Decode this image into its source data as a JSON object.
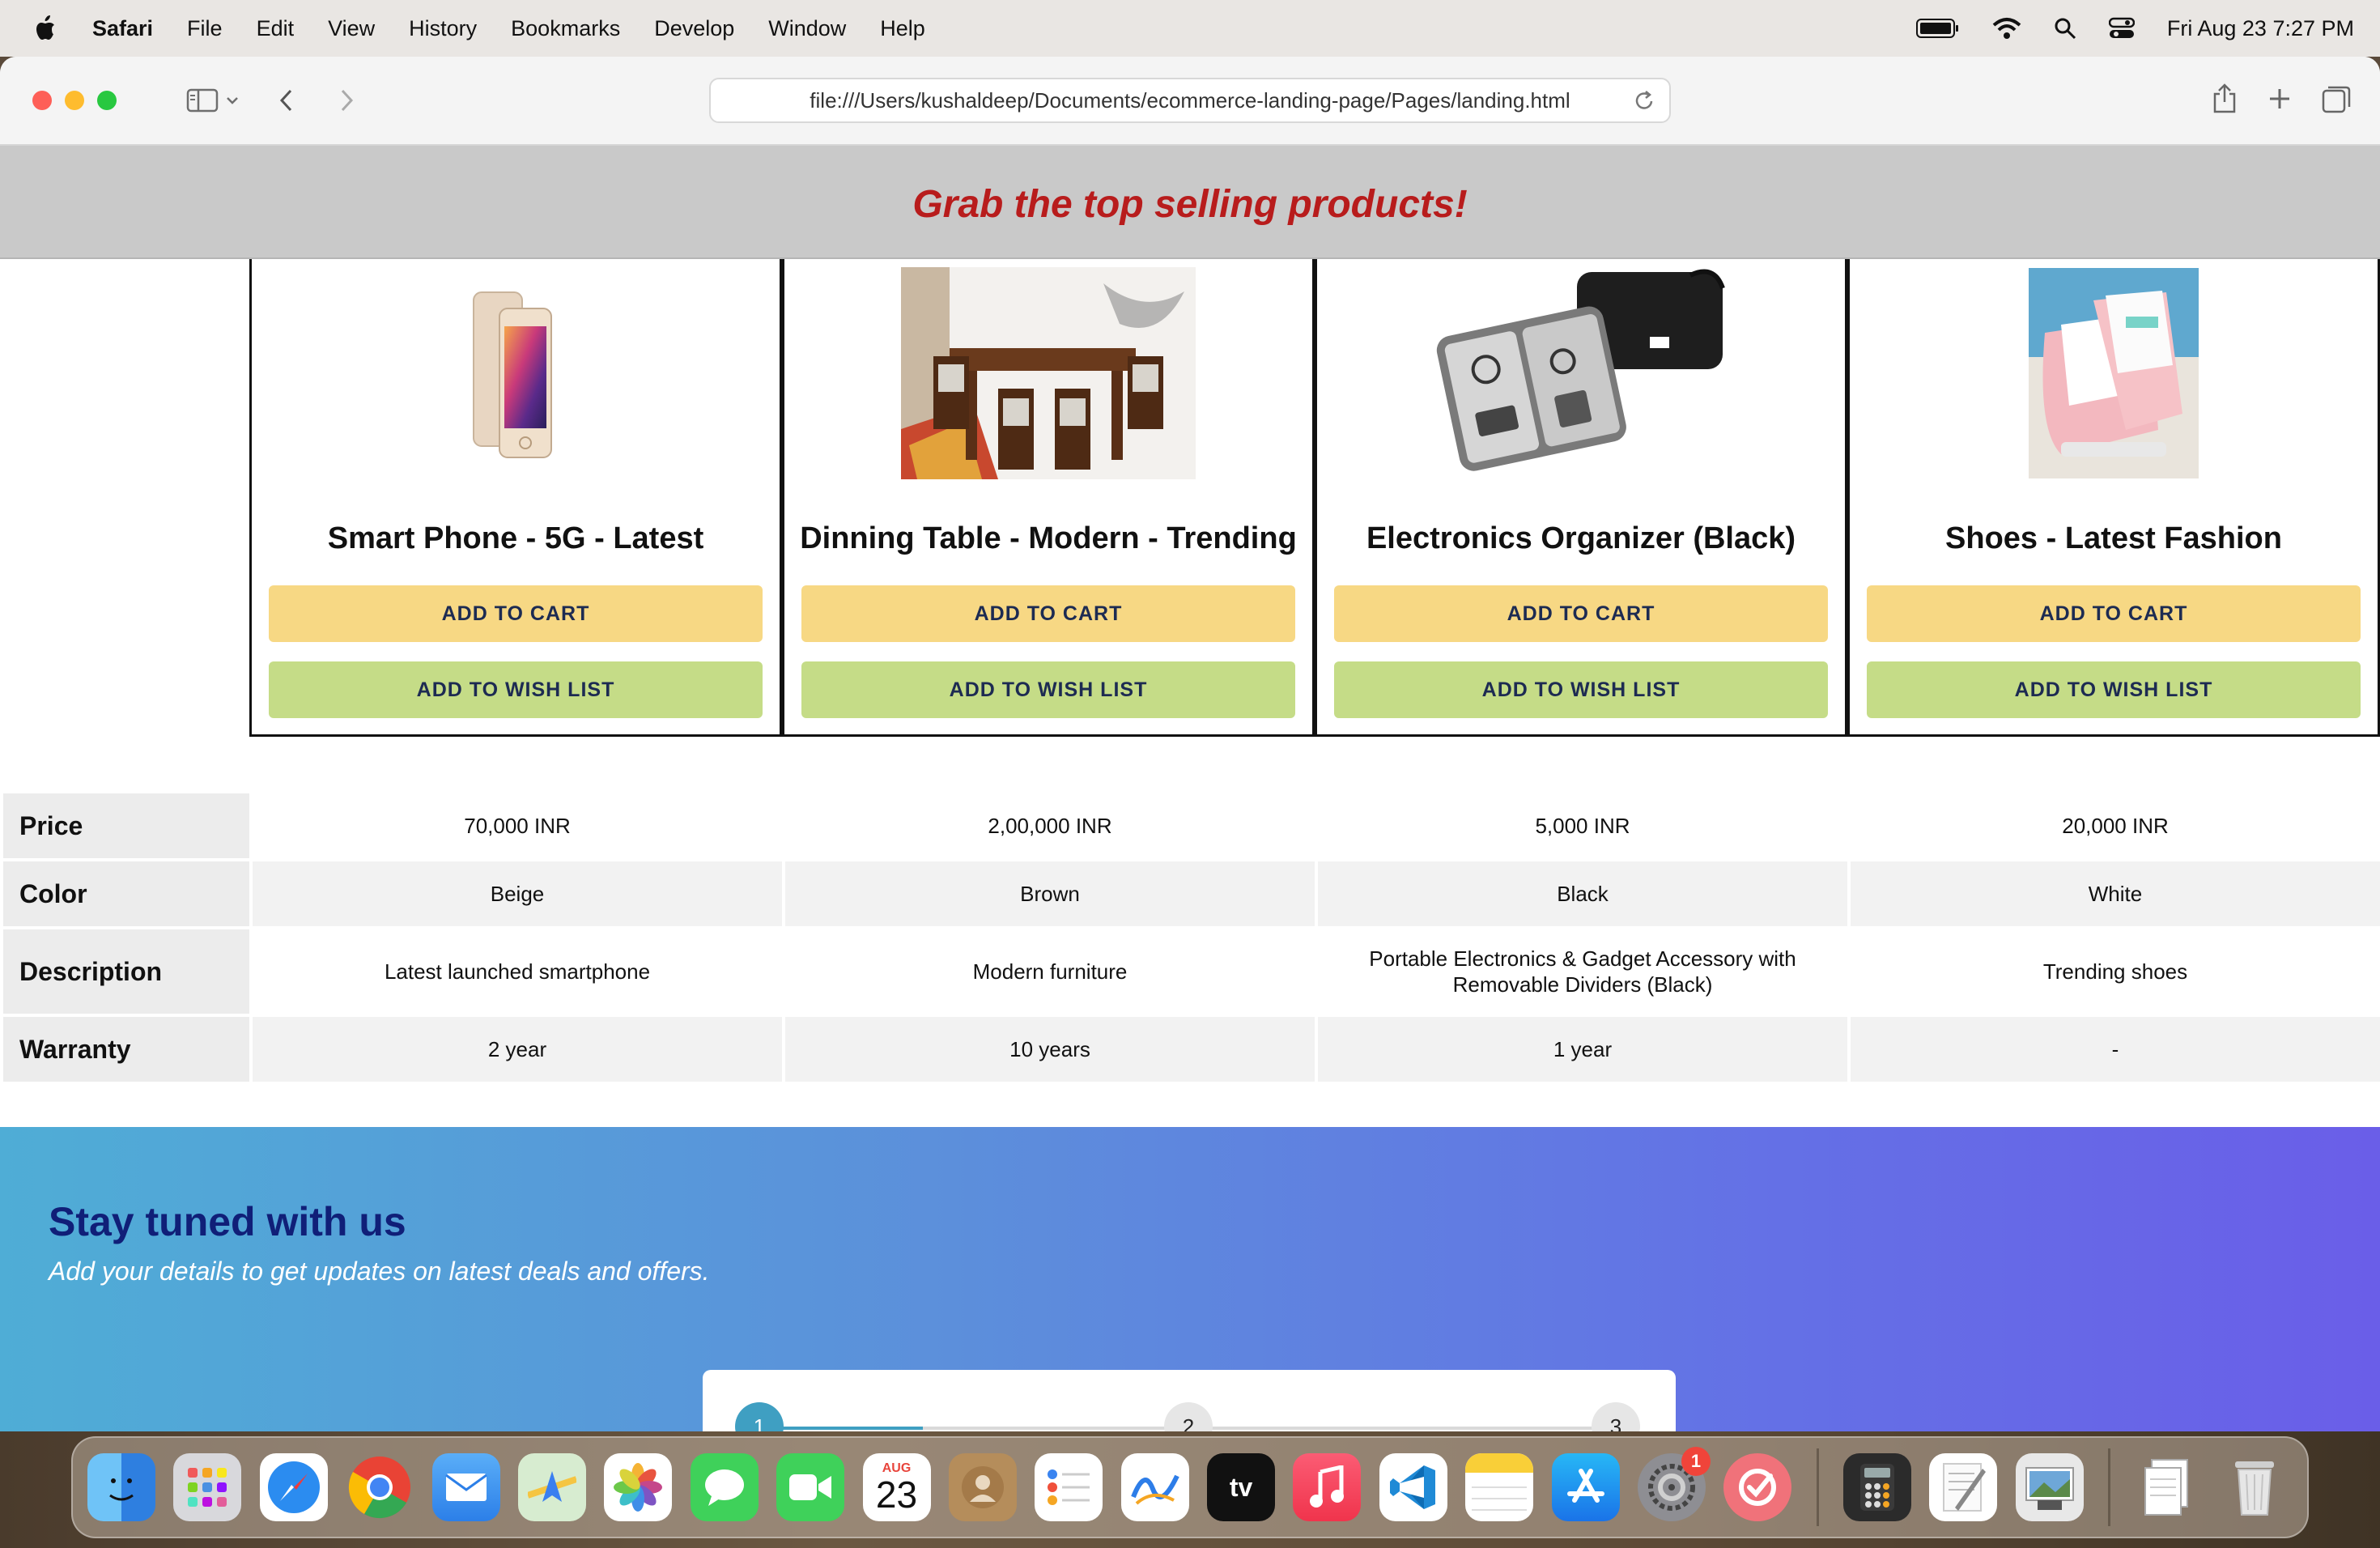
{
  "menubar": {
    "app": "Safari",
    "items": [
      "File",
      "Edit",
      "View",
      "History",
      "Bookmarks",
      "Develop",
      "Window",
      "Help"
    ],
    "datetime": "Fri Aug 23  7:27 PM"
  },
  "browser": {
    "url": "file:///Users/kushaldeep/Documents/ecommerce-landing-page/Pages/landing.html"
  },
  "page": {
    "banner_title": "Grab the top selling products!",
    "products": [
      {
        "name": "Smart Phone - 5G - Latest",
        "cart_label": "ADD TO CART",
        "wish_label": "ADD TO WISH LIST"
      },
      {
        "name": "Dinning Table - Modern - Trending",
        "cart_label": "ADD TO CART",
        "wish_label": "ADD TO WISH LIST"
      },
      {
        "name": "Electronics Organizer (Black)",
        "cart_label": "ADD TO CART",
        "wish_label": "ADD TO WISH LIST"
      },
      {
        "name": "Shoes - Latest Fashion",
        "cart_label": "ADD TO CART",
        "wish_label": "ADD TO WISH LIST"
      }
    ],
    "specs": {
      "labels": [
        "Price",
        "Color",
        "Description",
        "Warranty"
      ],
      "price": [
        "70,000 INR",
        "2,00,000 INR",
        "5,000 INR",
        "20,000 INR"
      ],
      "color": [
        "Beige",
        "Brown",
        "Black",
        "White"
      ],
      "description": [
        "Latest launched smartphone",
        "Modern furniture",
        "Portable Electronics & Gadget Accessory with Removable Dividers (Black)",
        "Trending shoes"
      ],
      "warranty": [
        "2 year",
        "10 years",
        "1 year",
        "-"
      ]
    },
    "newsletter": {
      "title": "Stay tuned with us",
      "subtitle": "Add your details to get updates on latest deals and offers.",
      "steps": [
        "1",
        "2",
        "3"
      ]
    }
  },
  "dock": {
    "calendar_month": "AUG",
    "calendar_day": "23",
    "settings_badge": "1",
    "apps": [
      "finder-icon",
      "launchpad-icon",
      "safari-icon",
      "chrome-icon",
      "mail-icon",
      "maps-icon",
      "photos-icon",
      "messages-icon",
      "facetime-icon",
      "calendar-icon",
      "contacts-icon",
      "reminders-icon",
      "freeform-icon",
      "appletv-icon",
      "music-icon",
      "vscode-icon",
      "notes-icon",
      "appstore-icon",
      "settings-icon",
      "ticktick-icon",
      "calculator-icon",
      "textedit-icon",
      "preview-icon",
      "documents-icon",
      "trash-icon"
    ]
  }
}
